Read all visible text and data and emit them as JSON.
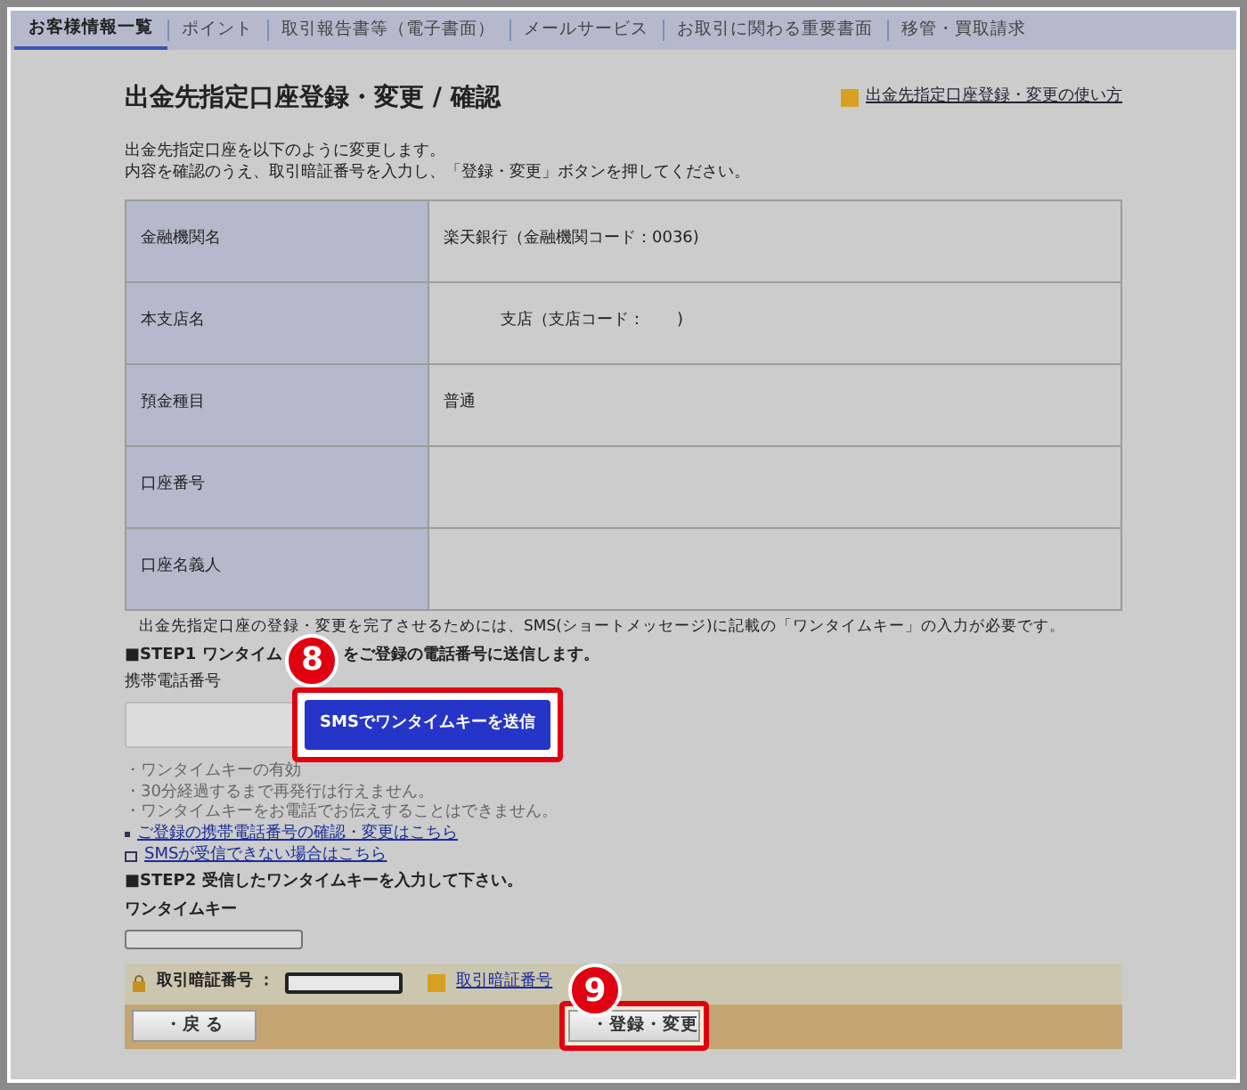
{
  "tabs": [
    {
      "label": "お客様情報一覧",
      "selected": true
    },
    {
      "label": "ポイント",
      "selected": false
    },
    {
      "label": "取引報告書等（電子書面）",
      "selected": false
    },
    {
      "label": "メールサービス",
      "selected": false
    },
    {
      "label": "お取引に関わる重要書面",
      "selected": false
    },
    {
      "label": "移管・買取請求",
      "selected": false
    }
  ],
  "title": "出金先指定口座登録・変更 / 確認",
  "help_link": "出金先指定口座登録・変更の使い方",
  "intro": [
    "出金先指定口座を以下のように変更します。",
    "内容を確認のうえ、取引暗証番号を入力し、「登録・変更」ボタンを押してください。"
  ],
  "table": {
    "rows": [
      {
        "label": "金融機関名",
        "value": "楽天銀行（金融機関コード：0036)"
      },
      {
        "label": "本支店名",
        "value": "支店（支店コード：　　)"
      },
      {
        "label": "預金種目",
        "value": "普通"
      },
      {
        "label": "口座番号"
      },
      {
        "label": "口座名義人"
      }
    ]
  },
  "sms_notice": "出金先指定口座の登録・変更を完了させるためには、SMS(ショートメッセージ)に記載の「ワンタイムキー」の入力が必要です。",
  "step1": {
    "heading": "■STEP1 ワンタイム",
    "heading_rest": "をご登録の電話番号に送信します。",
    "phone_label": "携帯電話番号",
    "send_button": "SMSでワンタイムキーを送信",
    "callout": "8",
    "notes": [
      "・ワンタイムキーの有効",
      "・30分経過するまで再発行は行えません。",
      "・ワンタイムキーをお電話でお伝えすることはできません。"
    ],
    "links": [
      {
        "kind": "dot",
        "label": "ご登録の携帯電話番号の確認・変更はこちら"
      },
      {
        "kind": "window",
        "label": "SMSが受信できない場合はこちら"
      }
    ]
  },
  "step2": {
    "heading": "■STEP2 受信したワンタイムキーを入力して下さい。",
    "key_label": "ワンタイムキー"
  },
  "pin": {
    "label": "取引暗証番号 ：",
    "help_link": "取引暗証番号"
  },
  "buttons": {
    "back": "・戻 る",
    "submit": "・登録・変更",
    "callout": "9"
  }
}
